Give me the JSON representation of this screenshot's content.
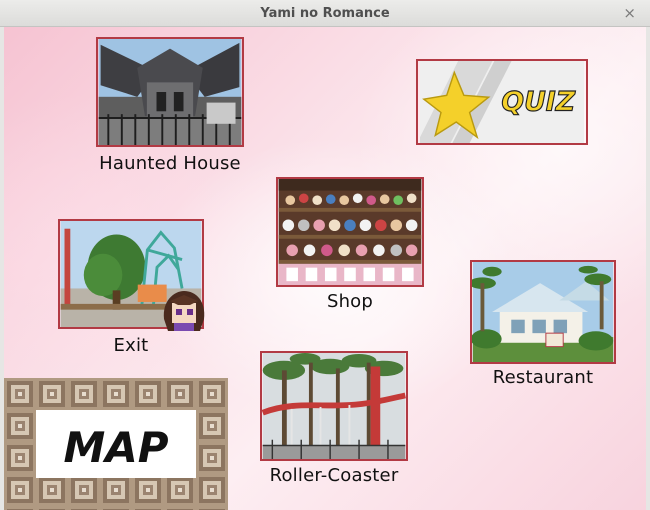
{
  "window": {
    "title": "Yami no Romance",
    "close_label": "×"
  },
  "locations": {
    "haunted_house": "Haunted House",
    "shop": "Shop",
    "exit": "Exit",
    "restaurant": "Restaurant",
    "roller_coaster": "Roller-Coaster"
  },
  "buttons": {
    "quiz": "QUIZ",
    "map": "MAP"
  },
  "colors": {
    "tile_border": "#b23a44",
    "quiz_star": "#f4d02a",
    "background": "#f8d0dc"
  }
}
